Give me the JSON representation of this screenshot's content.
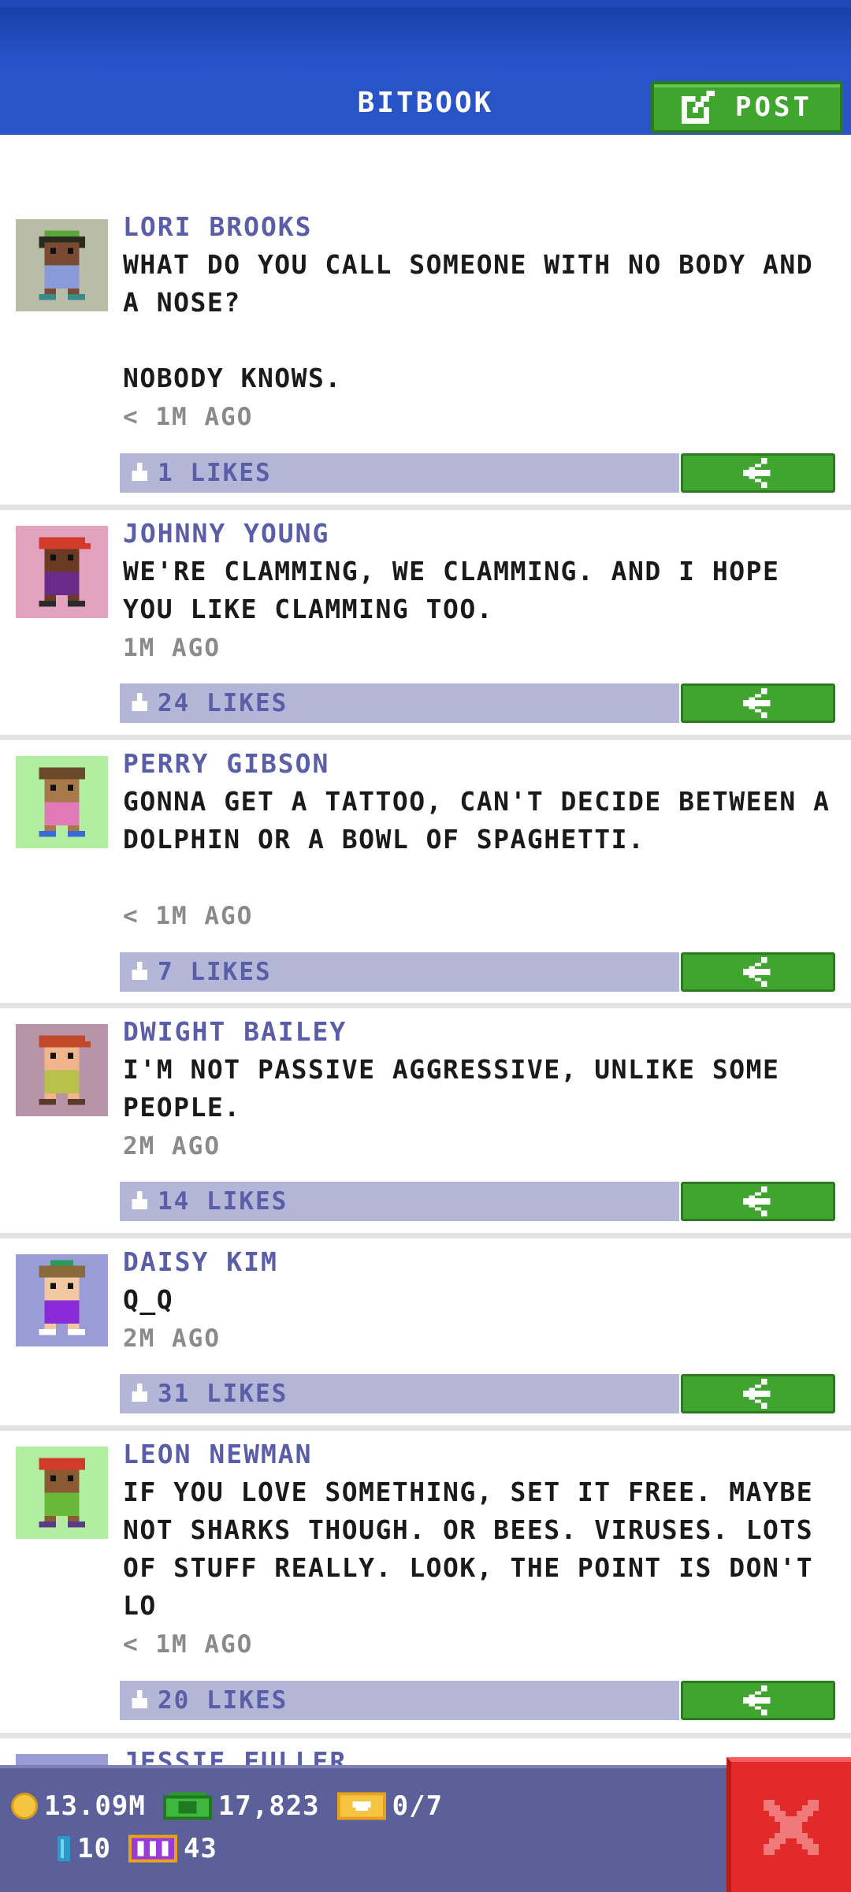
{
  "header": {
    "title": "BITBOOK",
    "post_label": "POST"
  },
  "posts": [
    {
      "author": "LORI BROOKS",
      "text": "WHAT DO YOU CALL SOMEONE WITH NO BODY AND A NOSE?\n\nNOBODY KNOWS.",
      "time": "< 1M AGO",
      "likes": "1 LIKES",
      "avatar_bg": "#b9bca6"
    },
    {
      "author": "JOHNNY YOUNG",
      "text": "WE'RE CLAMMING, WE CLAMMING. AND I HOPE YOU LIKE CLAMMING TOO.",
      "time": "1M AGO",
      "likes": "24 LIKES",
      "avatar_bg": "#e3a2bd"
    },
    {
      "author": "PERRY GIBSON",
      "text": "GONNA GET A TATTOO, CAN'T DECIDE BETWEEN A DOLPHIN OR A BOWL OF SPAGHETTI.",
      "time": "< 1M AGO",
      "likes": "7 LIKES",
      "avatar_bg": "#b2eea0"
    },
    {
      "author": "DWIGHT BAILEY",
      "text": "I'M NOT PASSIVE AGGRESSIVE, UNLIKE SOME PEOPLE.",
      "time": "2M AGO",
      "likes": "14 LIKES",
      "avatar_bg": "#b894a8"
    },
    {
      "author": "DAISY KIM",
      "text": "Q_Q",
      "time": "2M AGO",
      "likes": "31 LIKES",
      "avatar_bg": "#9a9cd8"
    },
    {
      "author": "LEON NEWMAN",
      "text": "IF YOU LOVE SOMETHING, SET IT FREE. MAYBE NOT SHARKS THOUGH. OR BEES. VIRUSES. LOTS OF STUFF REALLY. LOOK, THE POINT IS DON'T LO",
      "time": "< 1M AGO",
      "likes": "20 LIKES",
      "avatar_bg": "#b2eea0"
    },
    {
      "author": "JESSIE FULLER"
    }
  ],
  "hud": {
    "coins": "13.09M",
    "bux": "17,823",
    "tickets": "0/7",
    "cells": "10",
    "vip": "43"
  },
  "colors": {
    "header_blue": "#2753c9",
    "green_button": "#3fa52e",
    "like_bar": "#b4b6d8",
    "author_purple": "#5a5ea8",
    "hud_bg": "#5b5f9a",
    "close_red": "#e22a2a"
  }
}
